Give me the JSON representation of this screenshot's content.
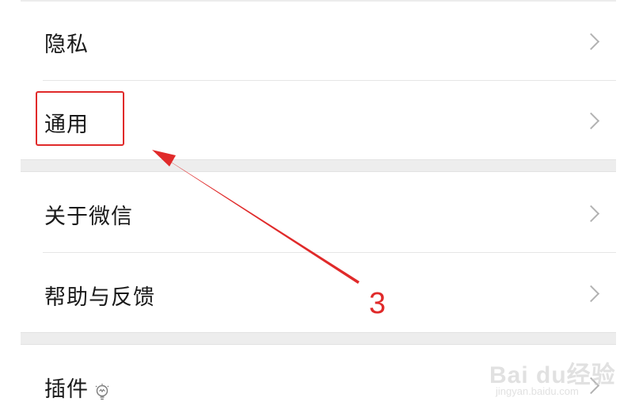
{
  "settings": {
    "items": [
      {
        "label": "隐私"
      },
      {
        "label": "通用"
      },
      {
        "label": "关于微信"
      },
      {
        "label": "帮助与反馈"
      },
      {
        "label": "插件",
        "icon": "lightbulb-icon"
      }
    ]
  },
  "annotation": {
    "step_number": "3",
    "color": "#e02a2a"
  },
  "watermark": {
    "main": "Bai du经验",
    "sub": "jingyan.baidu.com"
  }
}
